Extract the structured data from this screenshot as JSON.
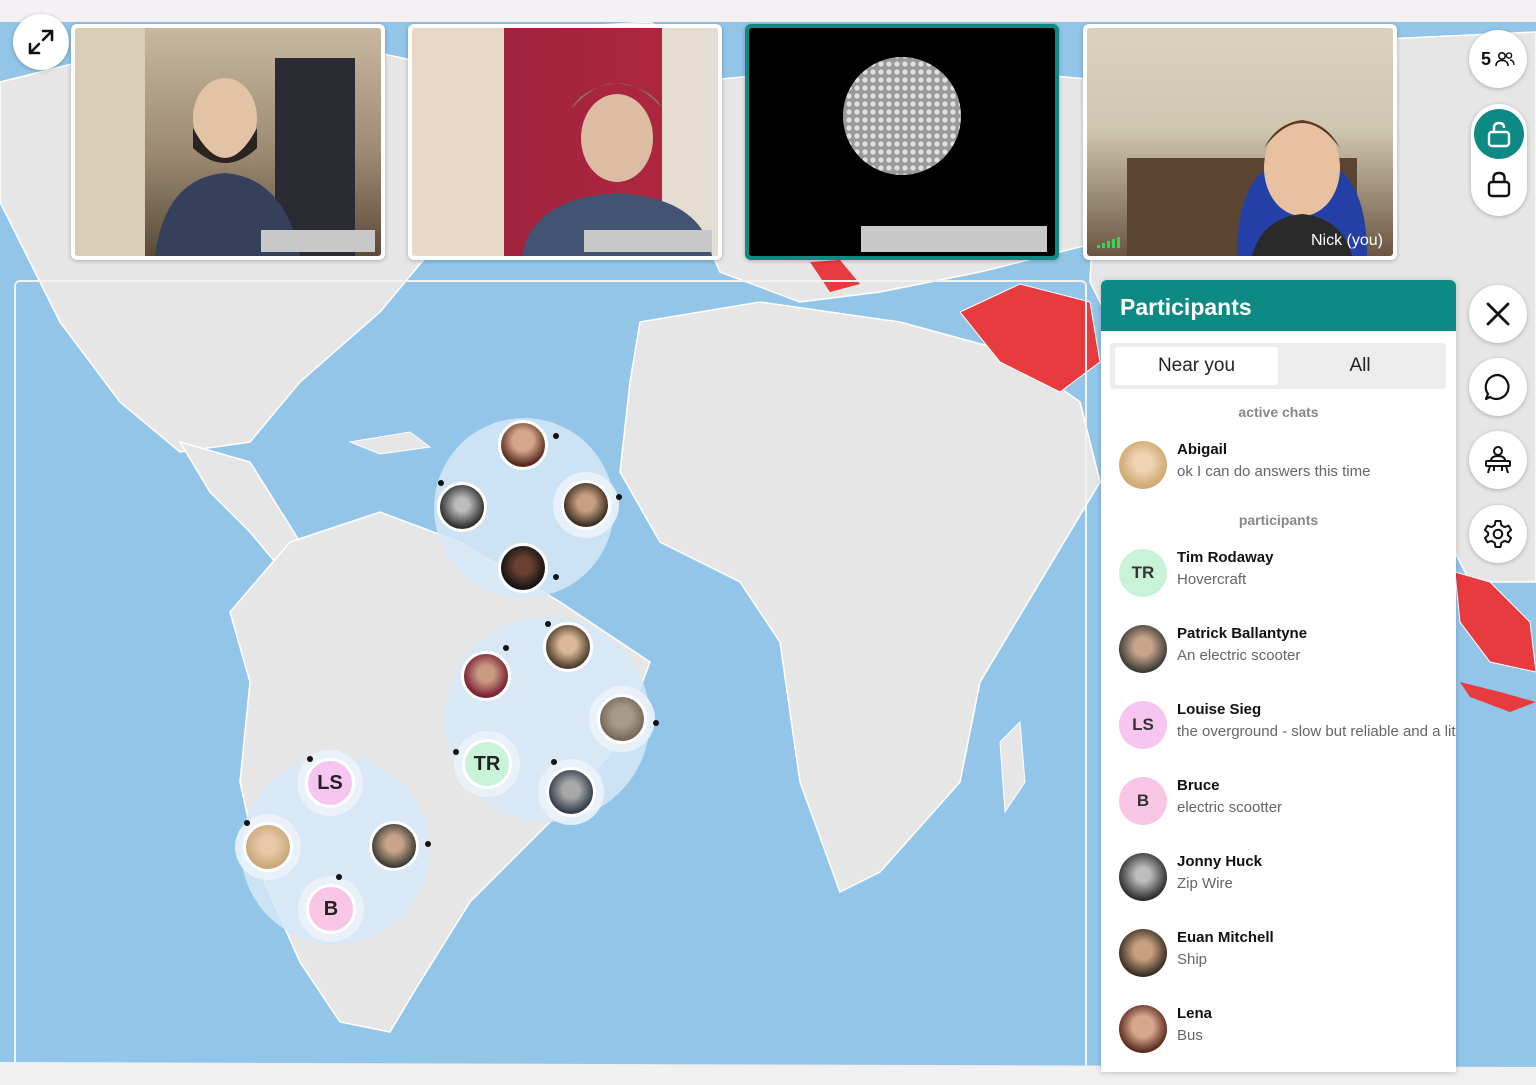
{
  "tiles": [
    {
      "name": "",
      "active": false
    },
    {
      "name": "",
      "active": false
    },
    {
      "name": "",
      "active": true
    },
    {
      "name": "Nick (you)",
      "active": false
    }
  ],
  "controls": {
    "participant_count": "5",
    "icons": [
      "expand-icon",
      "people-icon",
      "lock-open-icon",
      "lock-icon",
      "close-icon",
      "chat-icon",
      "lecture-icon",
      "gear-icon"
    ]
  },
  "map": {
    "clusters": [
      {
        "members": [
          "photo",
          "photo",
          "photo",
          "photo"
        ]
      },
      {
        "members": [
          "photo",
          "photo",
          "photo",
          "TR",
          "photo"
        ]
      },
      {
        "members": [
          "LS",
          "photo",
          "photo",
          "B"
        ]
      }
    ],
    "initials": {
      "tr": "TR",
      "ls": "LS",
      "b": "B"
    }
  },
  "panel": {
    "title": "Participants",
    "tabs": {
      "near": "Near you",
      "all": "All"
    },
    "active_chats_label": "active chats",
    "participants_label": "participants",
    "active_chats": [
      {
        "name": "Abigail",
        "message": "ok I can do answers this time"
      }
    ],
    "participants": [
      {
        "initials": "TR",
        "name": "Tim Rodaway",
        "transport": "Hovercraft",
        "color": "#c9f3d9"
      },
      {
        "initials": "",
        "name": "Patrick Ballantyne",
        "transport": "An electric scooter",
        "color": "#5a5a52"
      },
      {
        "initials": "LS",
        "name": "Louise Sieg",
        "transport": "the overground - slow but reliable and a lit",
        "color": "#f7c6f0"
      },
      {
        "initials": "B",
        "name": "Bruce",
        "transport": "electric scootter",
        "color": "#f9c6e6"
      },
      {
        "initials": "",
        "name": "Jonny Huck",
        "transport": "Zip Wire",
        "color": "#3c3c3c"
      },
      {
        "initials": "",
        "name": "Euan Mitchell",
        "transport": "Ship",
        "color": "#4a4642"
      },
      {
        "initials": "",
        "name": "Lena",
        "transport": "Bus",
        "color": "#8a5a48"
      }
    ]
  },
  "colors": {
    "accent": "#0e8a85",
    "ocean": "#93c5e8",
    "land": "#e6e6e6",
    "highlight": "#e83b3f"
  }
}
